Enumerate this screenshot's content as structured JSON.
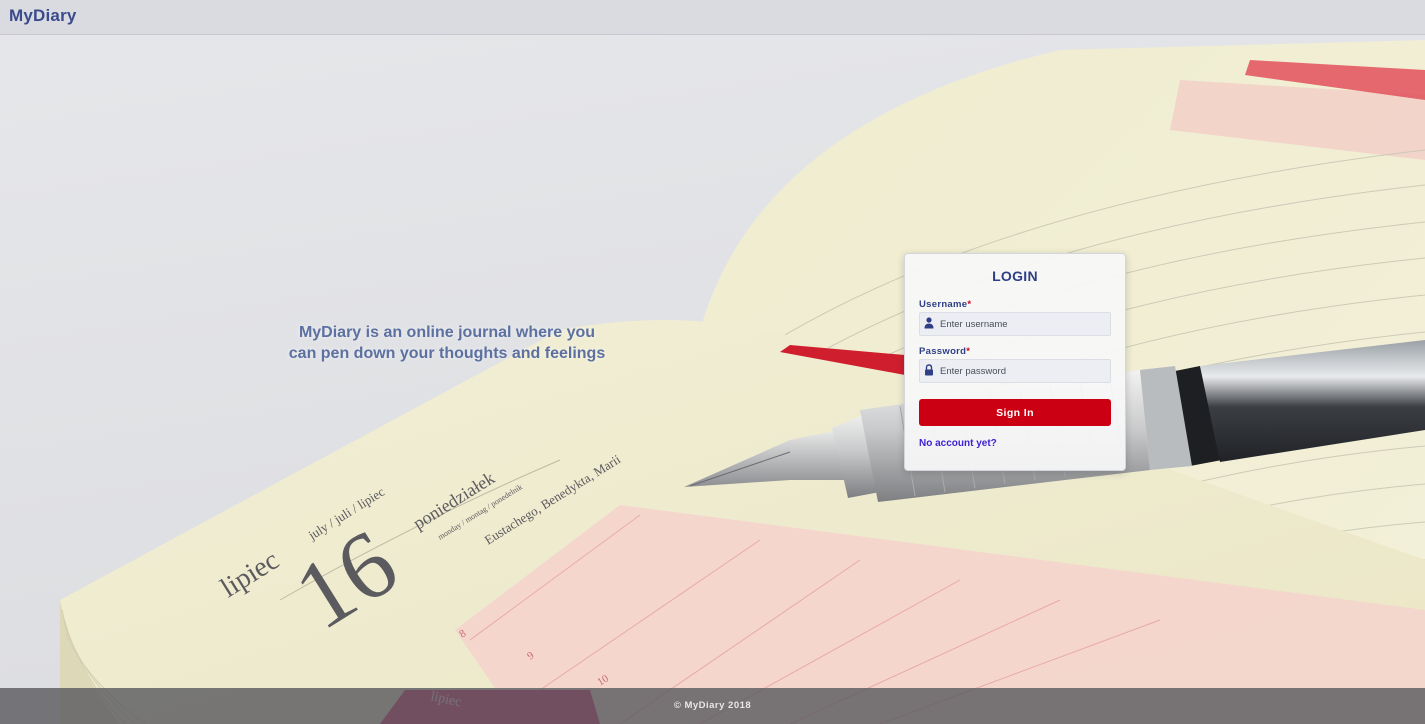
{
  "header": {
    "brand": "MyDiary"
  },
  "hero": {
    "tagline": "MyDiary is an online journal where you can pen down your thoughts and feelings"
  },
  "login": {
    "title": "LOGIN",
    "username_label": "Username",
    "username_placeholder": "Enter username",
    "username_value": "",
    "password_label": "Password",
    "password_placeholder": "Enter password",
    "password_value": "",
    "required_marker": "*",
    "submit_label": "Sign In",
    "signup_link": "No account yet?",
    "user_icon": "user-icon",
    "lock_icon": "lock-icon"
  },
  "background": {
    "month_label": "lipiec",
    "month_translations": "july / juli / lipiec",
    "day_number": "16",
    "weekday": "poniedziałek",
    "weekday_translations": "monday / montag / ponedelnik",
    "name_days": "Eustachego, Benedykta, Marii",
    "hour_marks": [
      "8",
      "9",
      "10"
    ],
    "tab_label": "lipiec"
  },
  "footer": {
    "copyright": "© MyDiary 2018"
  },
  "colors": {
    "brand": "#3b4a8c",
    "accent_red": "#cc0013",
    "link": "#3d1fd1",
    "label": "#2f3f86"
  }
}
